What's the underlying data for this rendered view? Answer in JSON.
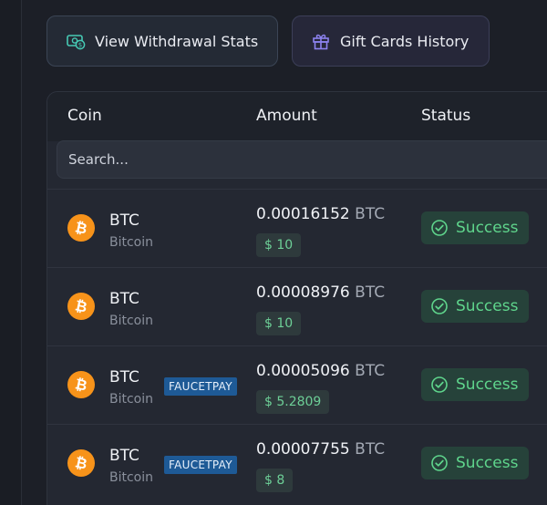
{
  "actions": {
    "withdraw_stats": "View Withdrawal Stats",
    "gift_cards": "Gift Cards History"
  },
  "table": {
    "headers": {
      "coin": "Coin",
      "amount": "Amount",
      "status": "Status"
    },
    "search_placeholder": "Search...",
    "rows": [
      {
        "symbol": "BTC",
        "name": "Bitcoin",
        "badge": "",
        "amount": "0.00016152",
        "unit": "BTC",
        "usd": "$ 10",
        "status": "Success"
      },
      {
        "symbol": "BTC",
        "name": "Bitcoin",
        "badge": "",
        "amount": "0.00008976",
        "unit": "BTC",
        "usd": "$ 10",
        "status": "Success"
      },
      {
        "symbol": "BTC",
        "name": "Bitcoin",
        "badge": "FAUCETPAY",
        "amount": "0.00005096",
        "unit": "BTC",
        "usd": "$ 5.2809",
        "status": "Success"
      },
      {
        "symbol": "BTC",
        "name": "Bitcoin",
        "badge": "FAUCETPAY",
        "amount": "0.00007755",
        "unit": "BTC",
        "usd": "$ 8",
        "status": "Success"
      }
    ]
  },
  "colors": {
    "success": "#5fd58c",
    "bitcoin": "#f7931a",
    "faucetpay": "#1e5a96"
  },
  "icons": {
    "withdraw": "money-stats-icon",
    "gift": "gift-icon",
    "coin": "bitcoin-icon",
    "status": "check-circle-icon"
  }
}
